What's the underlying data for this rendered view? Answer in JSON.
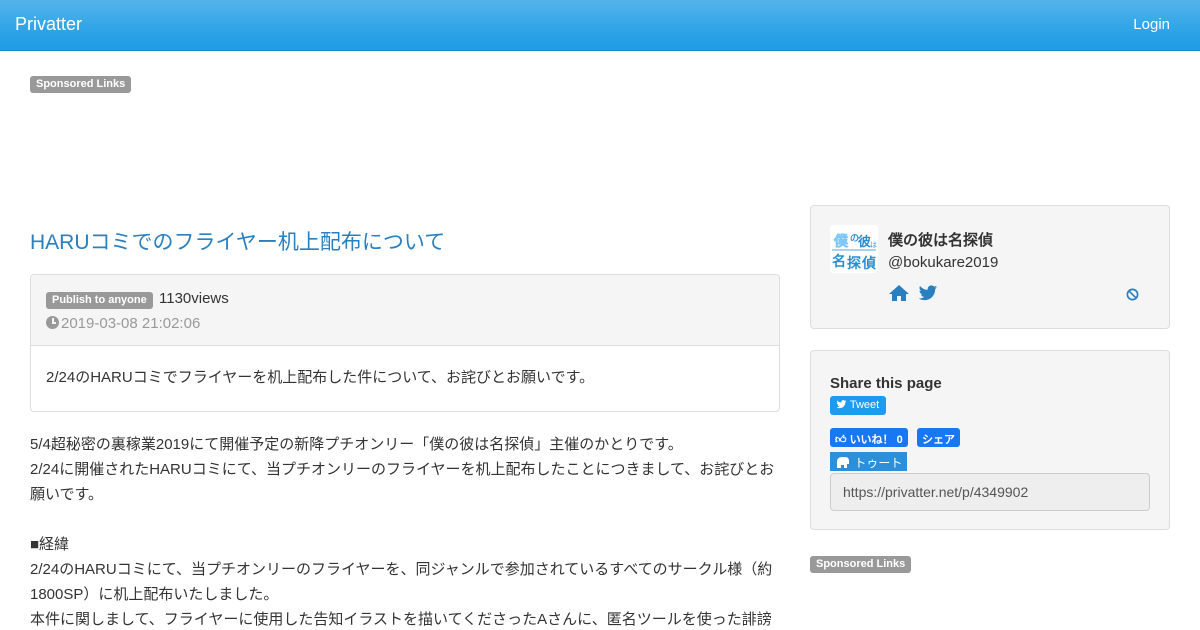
{
  "navbar": {
    "brand": "Privatter",
    "login": "Login"
  },
  "ads": {
    "sponsored_label": "Sponsored Links"
  },
  "post": {
    "title": "HARUコミでのフライヤー机上配布について",
    "visibility_badge": "Publish to anyone",
    "views": "1130views",
    "date": "2019-03-08 21:02:06",
    "summary": "2/24のHARUコミでフライヤーを机上配布した件について、お詫びとお願いです。",
    "paragraphs": [
      "5/4超秘密の裏稼業2019にて開催予定の新降プチオンリー「僕の彼は名探偵」主催のかとりです。",
      "2/24に開催されたHARUコミにて、当プチオンリーのフライヤーを机上配布したことにつきまして、お詫びとお願いです。",
      "",
      "■経緯",
      "2/24のHARUコミにて、当プチオンリーのフライヤーを、同ジャンルで参加されているすべてのサークル様（約1800SP）に机上配布いたしました。",
      "本件に関しまして、フライヤーに使用した告知イラストを描いてくださったAさんに、匿名ツールを使った誹謗"
    ]
  },
  "author": {
    "name": "僕の彼は名探偵",
    "handle": "@bokukare2019",
    "avatar_text": "僕の彼は名探偵",
    "icons": [
      "home-icon",
      "twitter-icon"
    ],
    "block_icon": "block-icon"
  },
  "share": {
    "heading": "Share this page",
    "tweet_label": "Tweet",
    "like_label": "いいね！ 0",
    "fb_share_label": "シェア",
    "toot_label": "トゥート",
    "url": "https://privatter.net/p/4349902"
  },
  "colors": {
    "navbar": "#2fa4e7",
    "link": "#2a7fbf",
    "twitter": "#1d9bf0",
    "facebook": "#1877f2"
  }
}
